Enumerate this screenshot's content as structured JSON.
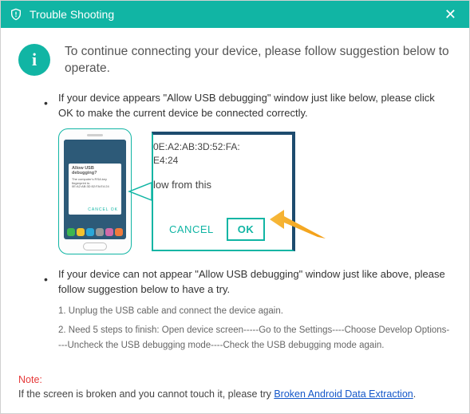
{
  "titlebar": {
    "title": "Trouble Shooting"
  },
  "intro": "To continue connecting your device, please follow suggestion below to operate.",
  "bullet1": "If your device appears \"Allow USB debugging\" window just like below, please click OK to make the current device  be connected correctly.",
  "bullet2": "If your device can not appear \"Allow USB debugging\" window just like above, please follow suggestion below to have a try.",
  "zoom": {
    "line1": "0E:A2:AB:3D:52:FA:",
    "line2": "E4:24",
    "line3": "low from this",
    "cancel": "CANCEL",
    "ok": "OK"
  },
  "phone_modal": {
    "title": "Allow USB debugging?",
    "body": "The computer's RSA key fingerprint is: 0E:A2:AB:3D:52:FA:E4:24",
    "check": "Always allow from this computer",
    "actions": "CANCEL   OK"
  },
  "steps": {
    "s1": "1. Unplug the USB cable and connect the device again.",
    "s2": "2. Need 5 steps to finish: Open device screen-----Go to the Settings----Choose Develop Options----Uncheck the USB debugging mode----Check the USB debugging mode again."
  },
  "footer": {
    "note_label": "Note:",
    "text": "If the screen is broken and you cannot touch it, please try ",
    "link": "Broken Android Data Extraction",
    "tail": "."
  }
}
